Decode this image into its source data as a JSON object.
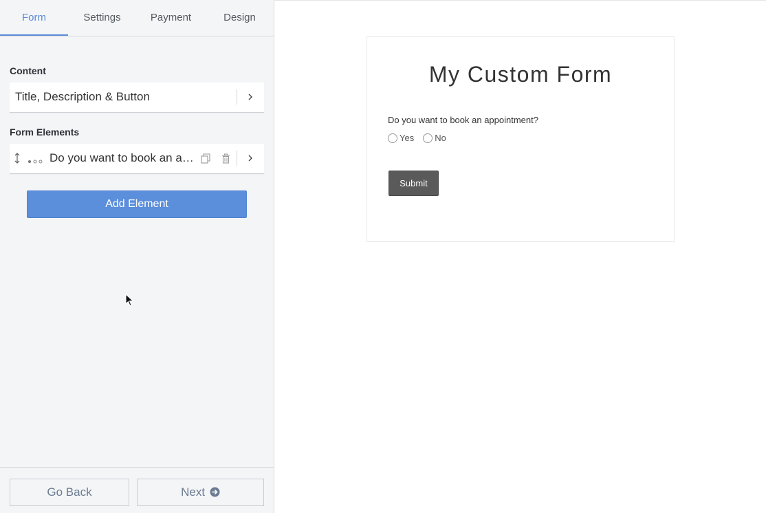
{
  "sidebar": {
    "tabs": [
      {
        "label": "Form",
        "active": true
      },
      {
        "label": "Settings",
        "active": false
      },
      {
        "label": "Payment",
        "active": false
      },
      {
        "label": "Design",
        "active": false
      }
    ],
    "content_section": {
      "heading": "Content",
      "item_label": "Title, Description & Button"
    },
    "elements_section": {
      "heading": "Form Elements",
      "items": [
        {
          "label": "Do you want to book an appointment?",
          "icons": [
            "drag-handle-icon",
            "radio-type-icon",
            "duplicate-icon",
            "trash-icon",
            "chevron-right-icon"
          ]
        }
      ]
    },
    "add_button_label": "Add Element",
    "footer": {
      "back_label": "Go Back",
      "next_label": "Next"
    }
  },
  "preview": {
    "title": "My Custom Form",
    "question": "Do you want to book an appointment?",
    "options": [
      "Yes",
      "No"
    ],
    "submit_label": "Submit"
  },
  "colors": {
    "accent": "#5b8edb",
    "active_tab": "#5b8bd6",
    "submit_bg": "#5a5a5a",
    "sidebar_bg": "#f4f5f7"
  }
}
